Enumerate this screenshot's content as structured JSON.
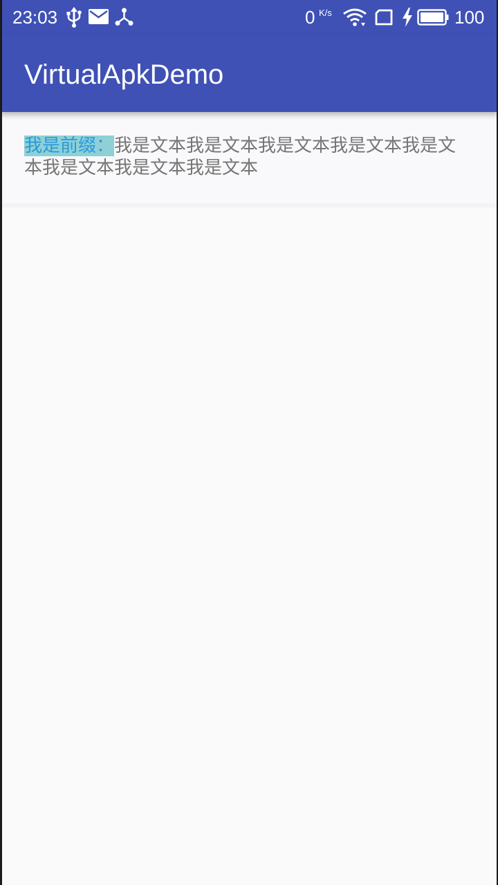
{
  "status_bar": {
    "time": "23:03",
    "net_speed": "0",
    "net_speed_unit": "K/s",
    "battery_level": "100",
    "icons": [
      "usb-icon",
      "mail-icon",
      "share-icon",
      "wifi-icon",
      "screen-icon",
      "charging-icon",
      "battery-icon"
    ]
  },
  "toolbar": {
    "title": "VirtualApkDemo"
  },
  "content": {
    "prefix": "我是前缀：",
    "text": "我是文本我是文本我是文本我是文本我是文本我是文本我是文本我是文本"
  },
  "colors": {
    "primary": "#3f51b5",
    "background": "#fafafa",
    "prefix_highlight": "#8ed0d6",
    "prefix_text": "#2a99db",
    "body_text": "#757575"
  }
}
